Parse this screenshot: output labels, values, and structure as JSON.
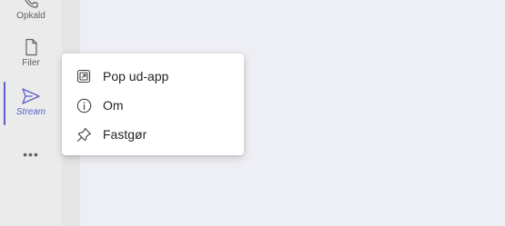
{
  "rail": {
    "items": [
      {
        "label": "Opkald",
        "icon": "phone-icon"
      },
      {
        "label": "Filer",
        "icon": "file-icon"
      },
      {
        "label": "Stream",
        "icon": "send-icon",
        "active": true
      }
    ],
    "more_label": "•••",
    "accent_color": "#5b5fc7"
  },
  "menu": {
    "items": [
      {
        "label": "Pop ud-app",
        "icon": "pop-out-icon"
      },
      {
        "label": "Om",
        "icon": "info-icon"
      },
      {
        "label": "Fastgør",
        "icon": "pin-icon"
      }
    ]
  }
}
